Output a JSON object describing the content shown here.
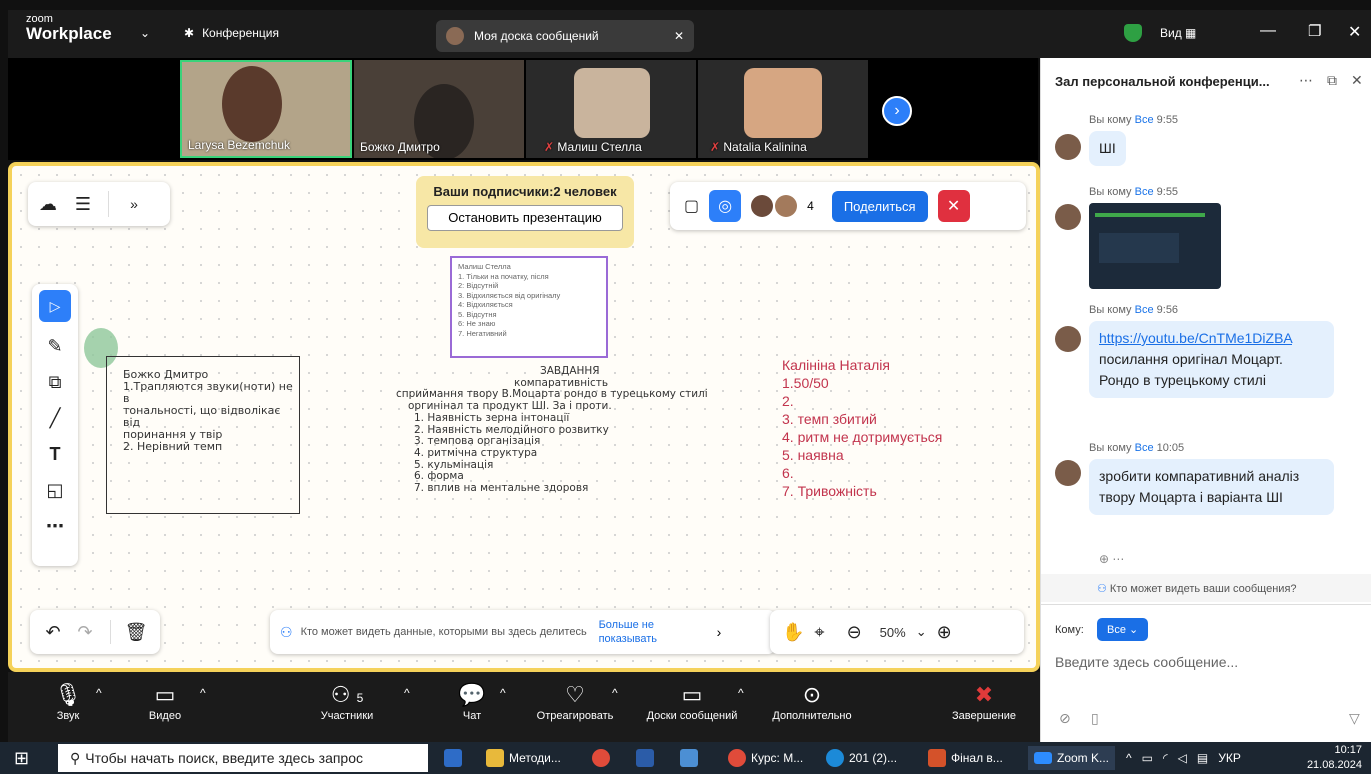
{
  "topbar": {
    "brand_small": "zoom",
    "brand_big": "Workplace",
    "conference": "Конференция",
    "tab": "Моя доска сообщений",
    "view": "Вид"
  },
  "participants": [
    {
      "name": "Larysa Bezemchuk"
    },
    {
      "name": "Божко Дмитро"
    },
    {
      "name": "Малиш Стелла"
    },
    {
      "name": "Natalia Kalinina"
    }
  ],
  "board": {
    "subs": "Ваши подписчики:2 человек",
    "stop": "Остановить презентацию",
    "avatar_count": "4",
    "share": "Поделиться",
    "note1": [
      "Божко Дмитро",
      "1.Трапляются звуки(ноти) не в",
      "тональності, що відволікає від",
      "поринання у твір",
      "2. Нерівний темп"
    ],
    "note2": [
      "Малиш Стелла",
      "1. Тільки на початку, після",
      "2: Відсутній",
      "3. Відхиляється від оригіналу",
      "4: Відхиляється",
      "5. Відсутня",
      "6: Не знаю",
      "7. Негативний"
    ],
    "task": [
      "ЗАВДАННЯ",
      "компаративність",
      "сприймання твору В.Моцарта рондо в турецькому стилі",
      "оргинінал та продукт ШІ. За і проти.",
      "1. Наявність зерна інтонації",
      "2. Наявність мелодійного розвитку",
      "3. темпова організація",
      "4. ритмічна структура",
      "5. кульмінація",
      "6. форма",
      "7. вплив на ментальне здоровя"
    ],
    "red": [
      "Калініна Наталія",
      "1.50/50",
      "2.",
      "3. темп збитий",
      "4. ритм не дотримується",
      "5. наявна",
      "6.",
      "7. Тривожність"
    ],
    "notice": "Кто может видеть данные, которыми вы здесь делитесь",
    "dont_show": "Больше не показывать",
    "zoom": "50%"
  },
  "bottom": {
    "audio": "Звук",
    "video": "Видео",
    "participants": "Участники",
    "participants_count": "5",
    "chat": "Чат",
    "react": "Отреагировать",
    "boards": "Доски сообщений",
    "more": "Дополнительно",
    "end": "Завершение"
  },
  "chat": {
    "title": "Зал персональной конференци...",
    "m1_from": "Вы кому",
    "m1_to": "Все",
    "m1_time": "9:55",
    "m1_text": "ШІ",
    "m2_from": "Вы кому",
    "m2_to": "Все",
    "m2_time": "9:55",
    "m3_from": "Вы кому",
    "m3_to": "Все",
    "m3_time": "9:56",
    "m3_link": "https://youtu.be/CnTMe1DiZBA",
    "m3_text": "посилання оригінал Моцарт. Рондо в турецькому стилі",
    "m4_from": "Вы кому",
    "m4_to": "Все",
    "m4_time": "10:05",
    "m4_text": "зробити компаративний аналіз твору Моцарта і варіанта ШІ",
    "who": "Кто может видеть ваши сообщения?",
    "to_label": "Кому:",
    "to_value": "Все",
    "placeholder": "Введите здесь сообщение..."
  },
  "taskbar": {
    "search": "Чтобы начать поиск, введите здесь запрос",
    "t1": "Методи...",
    "t2": "Курс: М...",
    "t3": "201 (2)...",
    "t4": "Фінал в...",
    "t5": "Zoom K...",
    "lang": "УКР",
    "time": "10:17",
    "date": "21.08.2024"
  }
}
